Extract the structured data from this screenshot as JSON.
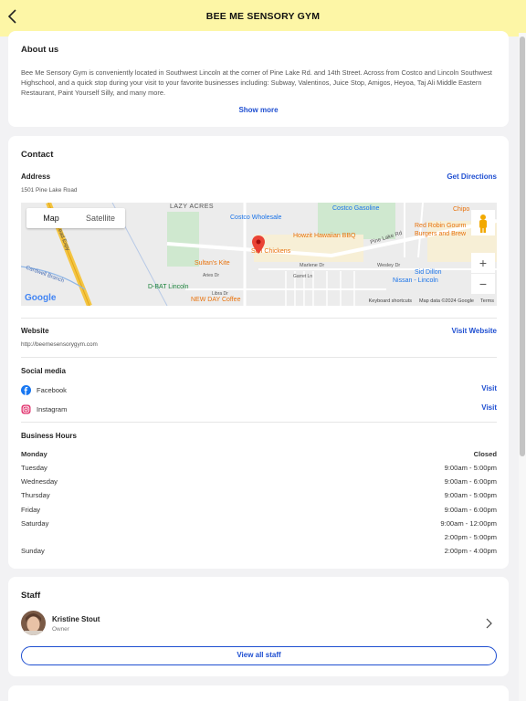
{
  "header": {
    "title": "BEE ME SENSORY GYM"
  },
  "about": {
    "heading": "About us",
    "text": "Bee Me Sensory Gym is conveniently located in Southwest Lincoln at the corner of Pine Lake Rd. and 14th Street.  Across from Costco and Lincoln Southwest Highschool, and a quick stop during your visit to your favorite businesses including: Subway, Valentinos, Juice Stop, Amigos, Heyoa, Taj Ali Middle Eastern Restaurant, Paint Yourself Silly, and many more.",
    "show_more": "Show more"
  },
  "contact": {
    "heading": "Contact",
    "address_label": "Address",
    "address": "1501 Pine Lake Road",
    "directions": "Get Directions",
    "map": {
      "tab_map": "Map",
      "tab_satellite": "Satellite",
      "labels": {
        "lazy_acres": "LAZY ACRES",
        "costco_wholesale": "Costco Wholesale",
        "costco_gasoline": "Costco Gasoline",
        "chipotle": "Chipo",
        "red_robin_1": "Red Robin Gourm",
        "red_robin_2": "Burgers and Brew",
        "howzit": "Howzit Hawaiian BBQ",
        "pine_lake_rd": "Pine Lake Rd",
        "sultans": "Sultan's Kite",
        "sun_chickens": "Sun Chickens",
        "marlene": "Marlene Dr",
        "wesley": "Wesley Dr",
        "sid_dillon_1": "Sid Dillon",
        "sid_dillon_2": "Nissan - Lincoln",
        "dbat": "D-BAT Lincoln",
        "new_day": "NEW DAY Coffee",
        "aries": "Aries Dr",
        "garret": "Garret Ln",
        "libra": "Libra Dr",
        "cardwell": "Cardwell Branch",
        "expy": "ead Expy",
        "google": "Google",
        "keyboard": "Keyboard shortcuts",
        "mapdata": "Map data ©2024 Google",
        "terms": "Terms"
      }
    },
    "website_label": "Website",
    "website_url": "http://beemesensorygym.com",
    "website_link": "Visit Website",
    "social_label": "Social media",
    "social": [
      {
        "name": "Facebook",
        "action": "Visit",
        "icon": "facebook-icon",
        "color": "#1877f2"
      },
      {
        "name": "Instagram",
        "action": "Visit",
        "icon": "instagram-icon",
        "color": "#e1306c"
      }
    ],
    "hours_label": "Business Hours",
    "hours": [
      {
        "day": "Monday",
        "time": "Closed"
      },
      {
        "day": "Tuesday",
        "time": "9:00am - 5:00pm"
      },
      {
        "day": "Wednesday",
        "time": "9:00am - 6:00pm"
      },
      {
        "day": "Thursday",
        "time": "9:00am - 5:00pm"
      },
      {
        "day": "Friday",
        "time": "9:00am - 6:00pm"
      },
      {
        "day": "Saturday",
        "time": "9:00am - 12:00pm"
      },
      {
        "day": "",
        "time": "2:00pm - 5:00pm"
      },
      {
        "day": "Sunday",
        "time": "2:00pm - 4:00pm"
      }
    ]
  },
  "staff": {
    "heading": "Staff",
    "members": [
      {
        "name": "Kristine Stout",
        "role": "Owner"
      }
    ],
    "view_all": "View all staff"
  },
  "colors": {
    "header_bg": "#fdf6a6",
    "link": "#1f4fd1"
  }
}
